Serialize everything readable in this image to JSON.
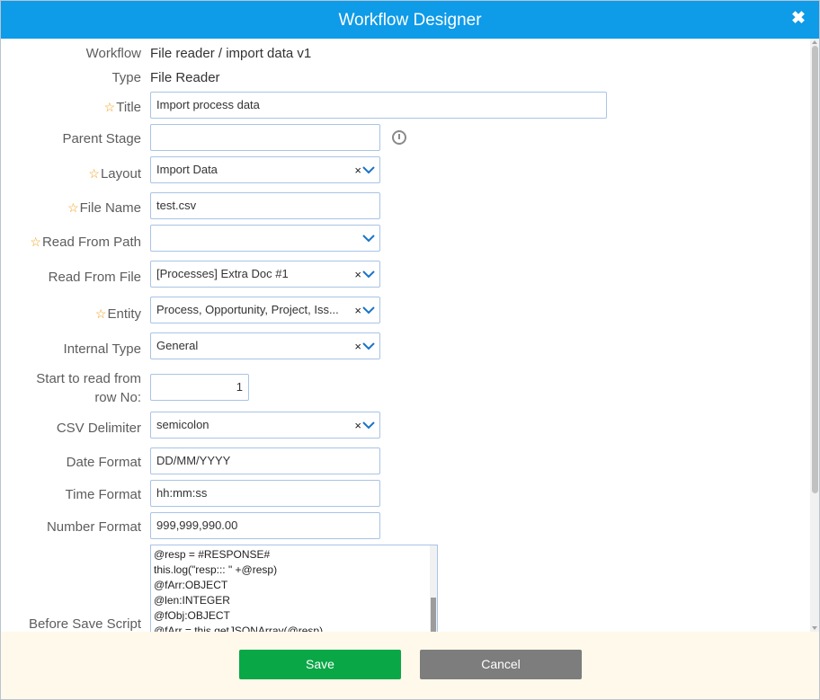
{
  "dialog": {
    "title": "Workflow Designer",
    "close_glyph": "✖"
  },
  "form": {
    "workflow": {
      "label": "Workflow",
      "value": "File reader / import data v1"
    },
    "type": {
      "label": "Type",
      "value": "File Reader"
    },
    "title": {
      "label": "Title",
      "required": true,
      "value": "Import process data"
    },
    "parent_stage": {
      "label": "Parent Stage",
      "value": ""
    },
    "layout": {
      "label": "Layout",
      "required": true,
      "value": "Import Data"
    },
    "file_name": {
      "label": "File Name",
      "required": true,
      "value": "test.csv"
    },
    "read_from_path": {
      "label": "Read From Path",
      "required": true,
      "value": ""
    },
    "read_from_file": {
      "label": "Read From File",
      "value": "[Processes] Extra Doc #1"
    },
    "entity": {
      "label": "Entity",
      "required": true,
      "value": "Process, Opportunity, Project, Iss..."
    },
    "internal_type": {
      "label": "Internal Type",
      "value": "General"
    },
    "start_row": {
      "label_line1": "Start to read from",
      "label_line2": "row No:",
      "value": "1"
    },
    "csv_delimiter": {
      "label": "CSV Delimiter",
      "value": "semicolon"
    },
    "date_format": {
      "label": "Date Format",
      "value": "DD/MM/YYYY"
    },
    "time_format": {
      "label": "Time Format",
      "value": "hh:mm:ss"
    },
    "number_format": {
      "label": "Number Format",
      "value": "999,999,990.00"
    },
    "before_save_script": {
      "label": "Before Save Script",
      "lines": [
        "@resp = #RESPONSE#",
        "this.log(\"resp::: \" +@resp)",
        "@fArr:OBJECT",
        "@len:INTEGER",
        "@fObj:OBJECT",
        "@fArr = this.getJSONArray(@resp)"
      ]
    }
  },
  "star_glyph": "☆",
  "clear_glyph": "×",
  "footer": {
    "save_label": "Save",
    "cancel_label": "Cancel"
  },
  "colors": {
    "header": "#0e9be8",
    "save": "#0aa747",
    "cancel": "#7d7d7d",
    "required_star": "#f39c12",
    "footer_bg": "#fef9ea"
  }
}
